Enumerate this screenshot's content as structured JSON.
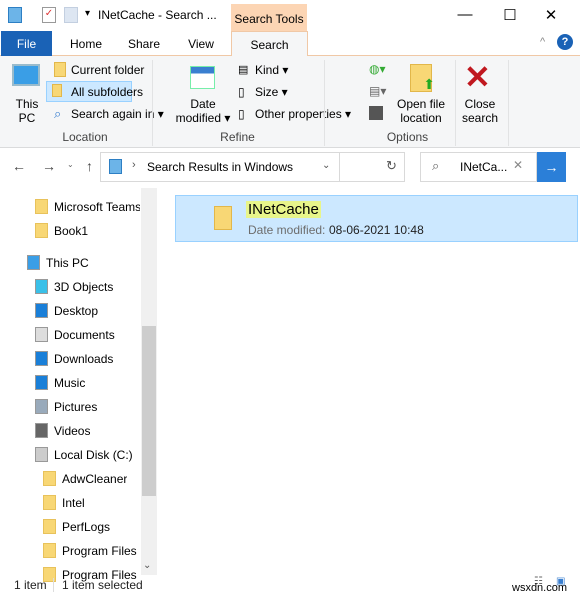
{
  "window": {
    "title": "INetCache - Search ...",
    "context_tab": "Search Tools",
    "minimize": "—",
    "maximize": "☐",
    "close": "✕"
  },
  "tabs": [
    "File",
    "Home",
    "Share",
    "View",
    "Search"
  ],
  "ribbon": {
    "location": {
      "this_pc": [
        "This",
        "PC"
      ],
      "current_folder": "Current folder",
      "all_subfolders": "All subfolders",
      "search_again": "Search again in",
      "group": "Location"
    },
    "refine": {
      "date_modified": [
        "Date",
        "modified"
      ],
      "kind": "Kind",
      "size": "Size",
      "other": "Other properties",
      "group": "Refine"
    },
    "options": {
      "open_location": [
        "Open file",
        "location"
      ],
      "group": "Options"
    },
    "close_search": [
      "Close",
      "search"
    ]
  },
  "address": {
    "path": "Search Results in Windows",
    "search_value": "INetCa..."
  },
  "nav": [
    "Microsoft Teams",
    "Book1",
    "This PC",
    "3D Objects",
    "Desktop",
    "Documents",
    "Downloads",
    "Music",
    "Pictures",
    "Videos",
    "Local Disk (C:)",
    "AdwCleaner",
    "Intel",
    "PerfLogs",
    "Program Files",
    "Program Files ("
  ],
  "result": {
    "name": "INetCache",
    "date_label": "Date modified:",
    "date_value": "08-06-2021 10:48"
  },
  "status": {
    "count": "1 item",
    "selected": "1 item selected"
  },
  "watermark": "wsxdn.com",
  "colors": {
    "accent": "#1a62b6",
    "selection": "#cce8ff",
    "context_tab": "#fcd5b4",
    "go_button": "#2b7fd8"
  }
}
